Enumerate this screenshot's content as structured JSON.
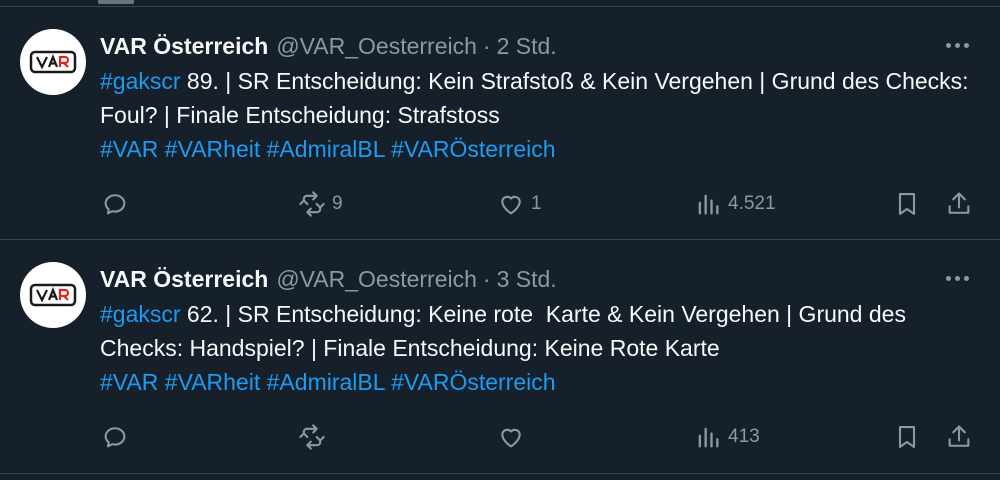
{
  "tweets": [
    {
      "author_name": "VAR Österreich",
      "handle": "@VAR_Oesterreich",
      "separator": "·",
      "time": "2 Std.",
      "body_parts": [
        {
          "text": "#gakscr",
          "hashtag": true
        },
        {
          "text": " 89. | SR Entscheidung: Kein Strafstoß & Kein Vergehen | Grund des Checks: Foul? | Finale Entscheidung: Strafstoss",
          "hashtag": false
        }
      ],
      "hashtags": [
        "#VAR",
        "#VARheit",
        "#AdmiralBL",
        "#VARÖsterreich"
      ],
      "stats": {
        "reposts": "9",
        "likes": "1",
        "views": "4.521"
      }
    },
    {
      "author_name": "VAR Österreich",
      "handle": "@VAR_Oesterreich",
      "separator": "·",
      "time": "3 Std.",
      "body_parts": [
        {
          "text": "#gakscr",
          "hashtag": true
        },
        {
          "text": " 62. | SR Entscheidung: Keine rote  Karte & Kein Vergehen | Grund des Checks: Handspiel? | Finale Entscheidung: Keine Rote Karte",
          "hashtag": false
        }
      ],
      "hashtags": [
        "#VAR",
        "#VARheit",
        "#AdmiralBL",
        "#VARÖsterreich"
      ],
      "stats": {
        "reposts": "",
        "likes": "",
        "views": "413"
      }
    }
  ],
  "icons": {
    "avatar": "var-logo-icon",
    "more": "more-horizontal-icon",
    "reply": "reply-icon",
    "repost": "repost-icon",
    "like": "heart-icon",
    "views": "analytics-icon",
    "bookmark": "bookmark-icon",
    "share": "share-icon"
  },
  "colors": {
    "background": "#15202b",
    "text": "#f7f9f9",
    "muted": "#8b98a5",
    "link": "#1d9bf0",
    "divider": "#38444d",
    "logo_red": "#e2231a"
  }
}
